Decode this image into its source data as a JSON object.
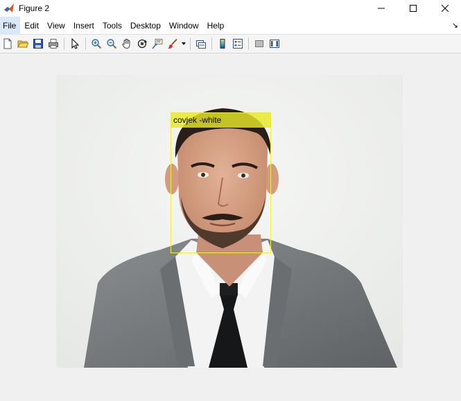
{
  "window": {
    "title": "Figure 2",
    "controls": [
      "minimize",
      "maximize",
      "close"
    ]
  },
  "menubar": {
    "items": [
      {
        "label": "File",
        "active": true
      },
      {
        "label": "Edit"
      },
      {
        "label": "View"
      },
      {
        "label": "Insert"
      },
      {
        "label": "Tools"
      },
      {
        "label": "Desktop"
      },
      {
        "label": "Window"
      },
      {
        "label": "Help"
      }
    ],
    "dock_glyph": "↘"
  },
  "toolbar": {
    "buttons": [
      "new-figure-icon",
      "open-file-icon",
      "save-icon",
      "print-icon",
      "select-arrow-icon",
      "zoom-in-icon",
      "zoom-out-icon",
      "pan-hand-icon",
      "rotate-3d-icon",
      "data-cursor-icon",
      "brush-icon",
      "link-plot-icon",
      "colorbar-icon",
      "legend-icon",
      "hide-plot-tools-icon",
      "show-plot-tools-icon"
    ]
  },
  "figure": {
    "detection": {
      "label": "covjek -white",
      "box_color": "#f3f02c",
      "label_bg": "#e8e828"
    }
  },
  "colors": {
    "accent_menu_active": "#dbe8f7",
    "background": "#f0f0f0"
  }
}
